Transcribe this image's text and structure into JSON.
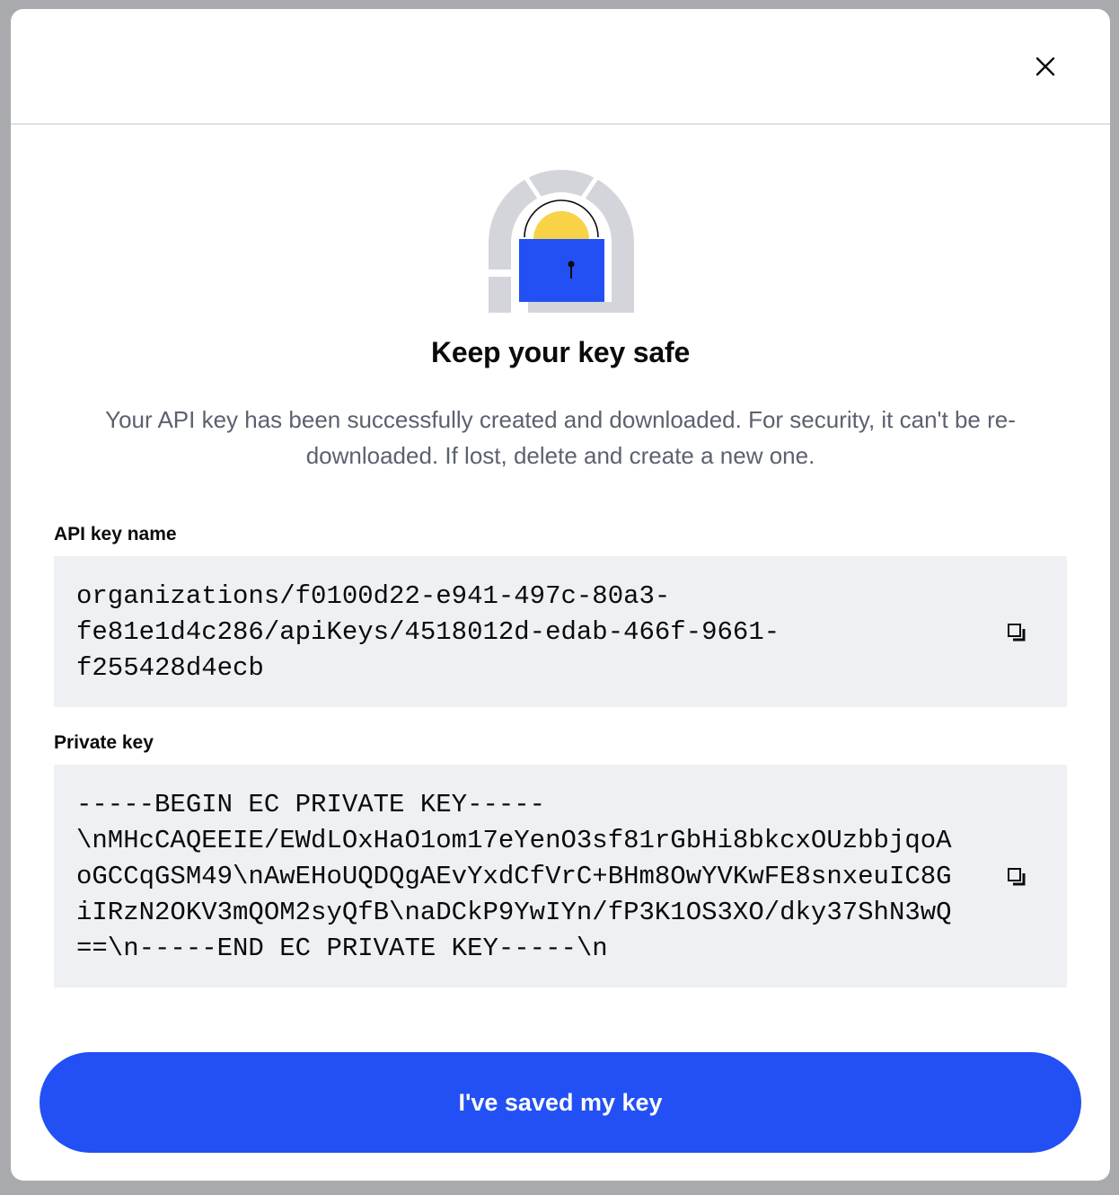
{
  "dialog": {
    "title": "Keep your key safe",
    "description": "Your API key has been successfully created and downloaded. For security, it can't be re-downloaded. If lost, delete and create a new one.",
    "close_icon": "close-icon"
  },
  "illustration": {
    "icon": "padlock-illustration",
    "colors": {
      "arch": "#d3d5db",
      "sun": "#f8d347",
      "lock": "#2250f4"
    }
  },
  "api_key_name": {
    "label": "API key name",
    "lines": [
      "organizations/f0100d22-e941-497c-80a3-",
      "fe81e1d4c286/apiKeys/4518012d-edab-466f-9661-",
      "f255428d4ecb"
    ],
    "copy_icon": "copy-icon"
  },
  "private_key": {
    "label": "Private key",
    "lines": [
      "-----BEGIN EC PRIVATE KEY-----",
      "\\nMHcCAQEEIE/EWdLOxHaO1om17eYenO3sf81rGbHi8bkcxOUzbbjqoA",
      "oGCCqGSM49\\nAwEHoUQDQgAEvYxdCfVrC+BHm8OwYVKwFE8snxeuIC8G",
      "iIRzN2OKV3mQOM2syQfB\\naDCkP9YwIYn/fP3K1OS3XO/dky37ShN3wQ",
      "==\\n-----END EC PRIVATE KEY-----\\n"
    ],
    "copy_icon": "copy-icon"
  },
  "primary_button": {
    "label": "I've saved my key"
  },
  "colors": {
    "accent": "#2250f4",
    "field_bg": "#eef0f3",
    "text_muted": "#5b616e"
  }
}
